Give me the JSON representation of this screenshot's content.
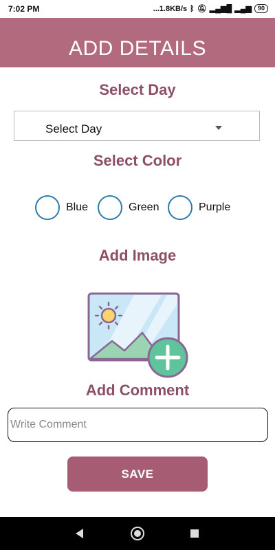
{
  "status_bar": {
    "time": "7:02 PM",
    "network_speed": "...1.8KB/s",
    "battery_level": "90"
  },
  "header": {
    "title": "ADD DETAILS"
  },
  "select_day": {
    "heading": "Select Day",
    "value": "Select Day"
  },
  "select_color": {
    "heading": "Select Color",
    "options": [
      "Blue",
      "Green",
      "Purple"
    ]
  },
  "add_image": {
    "heading": "Add Image"
  },
  "add_comment": {
    "heading": "Add Comment",
    "placeholder": "Write Comment",
    "value": ""
  },
  "actions": {
    "save_label": "SAVE"
  },
  "colors": {
    "header_bg": "#b26a7f",
    "heading_text": "#8c4f67",
    "radio_border": "#2a7aa8",
    "save_button_bg": "#a65d74"
  }
}
